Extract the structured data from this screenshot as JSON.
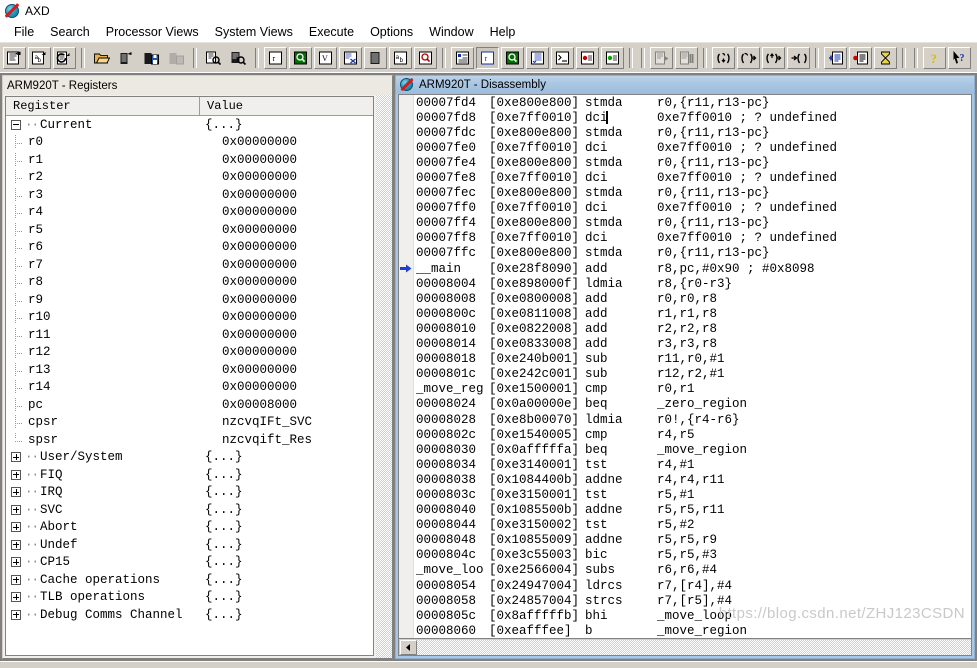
{
  "window": {
    "title": "AXD",
    "icon": "axd-app-icon"
  },
  "menu": {
    "items": [
      {
        "label": "File"
      },
      {
        "label": "Search"
      },
      {
        "label": "Processor Views"
      },
      {
        "label": "System Views"
      },
      {
        "label": "Execute"
      },
      {
        "label": "Options"
      },
      {
        "label": "Window"
      },
      {
        "label": "Help"
      }
    ]
  },
  "toolbar": {
    "groups": [
      {
        "buttons": [
          {
            "name": "load-image-icon",
            "tip": "Load Image",
            "state": "normal"
          },
          {
            "name": "load-debug-symbols-icon",
            "tip": "Load Debug Symbols",
            "state": "normal"
          },
          {
            "name": "reload-image-icon",
            "tip": "Reload Current Image",
            "state": "normal"
          }
        ]
      },
      {
        "buttons": [
          {
            "name": "open-file-icon",
            "tip": "Open File",
            "state": "normal"
          },
          {
            "name": "load-session-icon",
            "tip": "Load Session",
            "state": "normal"
          },
          {
            "name": "save-session-icon",
            "tip": "Save Session",
            "state": "normal"
          },
          {
            "name": "save-session-as-icon",
            "tip": "Save Session As",
            "state": "disabled"
          }
        ]
      },
      {
        "buttons": [
          {
            "name": "find-icon",
            "tip": "Find",
            "state": "normal"
          },
          {
            "name": "find-next-icon",
            "tip": "Find Next",
            "state": "normal"
          }
        ]
      },
      {
        "buttons": [
          {
            "name": "registers-view-icon",
            "tip": "Registers",
            "state": "normal"
          },
          {
            "name": "memory-view-icon",
            "tip": "Memory",
            "state": "normal"
          },
          {
            "name": "variables-view-icon",
            "tip": "Variables",
            "state": "normal"
          },
          {
            "name": "watch-view-icon",
            "tip": "Watch",
            "state": "normal"
          },
          {
            "name": "stack-view-icon",
            "tip": "Backtrace",
            "state": "normal"
          },
          {
            "name": "low-level-symbols-icon",
            "tip": "Low Level Symbols",
            "state": "normal"
          },
          {
            "name": "search-view-icon",
            "tip": "Search",
            "state": "normal"
          }
        ]
      },
      {
        "buttons": [
          {
            "name": "source-view-icon",
            "tip": "Source View",
            "state": "normal"
          },
          {
            "name": "disassembly-view-icon",
            "tip": "Disassembly",
            "state": "pressed"
          },
          {
            "name": "memory-map-icon",
            "tip": "Memory Map",
            "state": "normal"
          },
          {
            "name": "output-view-icon",
            "tip": "Output",
            "state": "normal"
          },
          {
            "name": "console-view-icon",
            "tip": "Console",
            "state": "normal"
          },
          {
            "name": "breakpoints-view-icon",
            "tip": "Breakpoints",
            "state": "normal"
          },
          {
            "name": "watchpoints-view-icon",
            "tip": "Watchpoints",
            "state": "normal"
          }
        ]
      },
      {
        "buttons": [
          {
            "name": "go-icon",
            "tip": "Go",
            "state": "disabled"
          },
          {
            "name": "stop-icon",
            "tip": "Stop",
            "state": "disabled"
          }
        ]
      },
      {
        "buttons": [
          {
            "name": "step-in-icon",
            "tip": "Step In",
            "state": "normal"
          },
          {
            "name": "step-icon",
            "tip": "Step",
            "state": "normal"
          },
          {
            "name": "step-out-icon",
            "tip": "Step Out",
            "state": "normal"
          },
          {
            "name": "run-to-cursor-icon",
            "tip": "Run To Cursor",
            "state": "normal"
          }
        ]
      },
      {
        "buttons": [
          {
            "name": "toggle-breakpoint-icon",
            "tip": "Toggle Breakpoint",
            "state": "normal"
          },
          {
            "name": "toggle-watchpoint-icon",
            "tip": "Toggle Watchpoint",
            "state": "normal"
          },
          {
            "name": "context-icon",
            "tip": "Processor Status",
            "state": "normal"
          }
        ]
      },
      {
        "buttons": [
          {
            "name": "help-icon",
            "tip": "Help",
            "state": "normal"
          },
          {
            "name": "context-help-icon",
            "tip": "Context Help",
            "state": "normal"
          }
        ]
      }
    ]
  },
  "registers_window": {
    "title": "ARM920T - Registers",
    "active": false,
    "columns": [
      "Register",
      "Value"
    ],
    "rows": [
      {
        "name": "Current",
        "value": "{...}",
        "level": 0,
        "expander": "minus"
      },
      {
        "name": "r0",
        "value": "0x00000000",
        "level": 1,
        "expander": "none"
      },
      {
        "name": "r1",
        "value": "0x00000000",
        "level": 1,
        "expander": "none"
      },
      {
        "name": "r2",
        "value": "0x00000000",
        "level": 1,
        "expander": "none"
      },
      {
        "name": "r3",
        "value": "0x00000000",
        "level": 1,
        "expander": "none"
      },
      {
        "name": "r4",
        "value": "0x00000000",
        "level": 1,
        "expander": "none"
      },
      {
        "name": "r5",
        "value": "0x00000000",
        "level": 1,
        "expander": "none"
      },
      {
        "name": "r6",
        "value": "0x00000000",
        "level": 1,
        "expander": "none"
      },
      {
        "name": "r7",
        "value": "0x00000000",
        "level": 1,
        "expander": "none"
      },
      {
        "name": "r8",
        "value": "0x00000000",
        "level": 1,
        "expander": "none"
      },
      {
        "name": "r9",
        "value": "0x00000000",
        "level": 1,
        "expander": "none"
      },
      {
        "name": "r10",
        "value": "0x00000000",
        "level": 1,
        "expander": "none"
      },
      {
        "name": "r11",
        "value": "0x00000000",
        "level": 1,
        "expander": "none"
      },
      {
        "name": "r12",
        "value": "0x00000000",
        "level": 1,
        "expander": "none"
      },
      {
        "name": "r13",
        "value": "0x00000000",
        "level": 1,
        "expander": "none"
      },
      {
        "name": "r14",
        "value": "0x00000000",
        "level": 1,
        "expander": "none"
      },
      {
        "name": "pc",
        "value": "0x00008000",
        "level": 1,
        "expander": "none"
      },
      {
        "name": "cpsr",
        "value": "nzcvqIFt_SVC",
        "level": 1,
        "expander": "none"
      },
      {
        "name": "spsr",
        "value": "nzcvqift_Res",
        "level": 1,
        "expander": "none",
        "last": true
      },
      {
        "name": "User/System",
        "value": "{...}",
        "level": 0,
        "expander": "plus"
      },
      {
        "name": "FIQ",
        "value": "{...}",
        "level": 0,
        "expander": "plus"
      },
      {
        "name": "IRQ",
        "value": "{...}",
        "level": 0,
        "expander": "plus"
      },
      {
        "name": "SVC",
        "value": "{...}",
        "level": 0,
        "expander": "plus"
      },
      {
        "name": "Abort",
        "value": "{...}",
        "level": 0,
        "expander": "plus"
      },
      {
        "name": "Undef",
        "value": "{...}",
        "level": 0,
        "expander": "plus"
      },
      {
        "name": "CP15",
        "value": "{...}",
        "level": 0,
        "expander": "plus"
      },
      {
        "name": "Cache operations",
        "value": "{...}",
        "level": 0,
        "expander": "plus"
      },
      {
        "name": "TLB operations",
        "value": "{...}",
        "level": 0,
        "expander": "plus"
      },
      {
        "name": "Debug Comms Channel",
        "value": "{...}",
        "level": 0,
        "expander": "plus"
      }
    ]
  },
  "disassembly_window": {
    "title": "ARM920T - Disassembly",
    "active": true,
    "current_marker": "pc-arrow",
    "caret_visible_row": 1,
    "rows": [
      {
        "addr": "00007fd4",
        "opcode": "[0xe800e800]",
        "mnemonic": "stmda",
        "args": "r0,{r11,r13-pc}",
        "current": false
      },
      {
        "addr": "00007fd8",
        "opcode": "[0xe7ff0010]",
        "mnemonic": "dci",
        "args": "0xe7ff0010 ; ? undefined",
        "current": false
      },
      {
        "addr": "00007fdc",
        "opcode": "[0xe800e800]",
        "mnemonic": "stmda",
        "args": "r0,{r11,r13-pc}",
        "current": false
      },
      {
        "addr": "00007fe0",
        "opcode": "[0xe7ff0010]",
        "mnemonic": "dci",
        "args": "0xe7ff0010 ; ? undefined",
        "current": false
      },
      {
        "addr": "00007fe4",
        "opcode": "[0xe800e800]",
        "mnemonic": "stmda",
        "args": "r0,{r11,r13-pc}",
        "current": false
      },
      {
        "addr": "00007fe8",
        "opcode": "[0xe7ff0010]",
        "mnemonic": "dci",
        "args": "0xe7ff0010 ; ? undefined",
        "current": false
      },
      {
        "addr": "00007fec",
        "opcode": "[0xe800e800]",
        "mnemonic": "stmda",
        "args": "r0,{r11,r13-pc}",
        "current": false
      },
      {
        "addr": "00007ff0",
        "opcode": "[0xe7ff0010]",
        "mnemonic": "dci",
        "args": "0xe7ff0010 ; ? undefined",
        "current": false
      },
      {
        "addr": "00007ff4",
        "opcode": "[0xe800e800]",
        "mnemonic": "stmda",
        "args": "r0,{r11,r13-pc}",
        "current": false
      },
      {
        "addr": "00007ff8",
        "opcode": "[0xe7ff0010]",
        "mnemonic": "dci",
        "args": "0xe7ff0010 ; ? undefined",
        "current": false
      },
      {
        "addr": "00007ffc",
        "opcode": "[0xe800e800]",
        "mnemonic": "stmda",
        "args": "r0,{r11,r13-pc}",
        "current": false
      },
      {
        "addr": "__main",
        "opcode": "[0xe28f8090]",
        "mnemonic": "add",
        "args": "r8,pc,#0x90 ; #0x8098",
        "current": true
      },
      {
        "addr": "00008004",
        "opcode": "[0xe898000f]",
        "mnemonic": "ldmia",
        "args": "r8,{r0-r3}",
        "current": false
      },
      {
        "addr": "00008008",
        "opcode": "[0xe0800008]",
        "mnemonic": "add",
        "args": "r0,r0,r8",
        "current": false
      },
      {
        "addr": "0000800c",
        "opcode": "[0xe0811008]",
        "mnemonic": "add",
        "args": "r1,r1,r8",
        "current": false
      },
      {
        "addr": "00008010",
        "opcode": "[0xe0822008]",
        "mnemonic": "add",
        "args": "r2,r2,r8",
        "current": false
      },
      {
        "addr": "00008014",
        "opcode": "[0xe0833008]",
        "mnemonic": "add",
        "args": "r3,r3,r8",
        "current": false
      },
      {
        "addr": "00008018",
        "opcode": "[0xe240b001]",
        "mnemonic": "sub",
        "args": "r11,r0,#1",
        "current": false
      },
      {
        "addr": "0000801c",
        "opcode": "[0xe242c001]",
        "mnemonic": "sub",
        "args": "r12,r2,#1",
        "current": false
      },
      {
        "addr": "_move_reg",
        "opcode": "[0xe1500001]",
        "mnemonic": "cmp",
        "args": "r0,r1",
        "current": false
      },
      {
        "addr": "00008024",
        "opcode": "[0x0a00000e]",
        "mnemonic": "beq",
        "args": "_zero_region",
        "current": false
      },
      {
        "addr": "00008028",
        "opcode": "[0xe8b00070]",
        "mnemonic": "ldmia",
        "args": "r0!,{r4-r6}",
        "current": false
      },
      {
        "addr": "0000802c",
        "opcode": "[0xe1540005]",
        "mnemonic": "cmp",
        "args": "r4,r5",
        "current": false
      },
      {
        "addr": "00008030",
        "opcode": "[0x0afffffa]",
        "mnemonic": "beq",
        "args": "_move_region",
        "current": false
      },
      {
        "addr": "00008034",
        "opcode": "[0xe3140001]",
        "mnemonic": "tst",
        "args": "r4,#1",
        "current": false
      },
      {
        "addr": "00008038",
        "opcode": "[0x1084400b]",
        "mnemonic": "addne",
        "args": "r4,r4,r11",
        "current": false
      },
      {
        "addr": "0000803c",
        "opcode": "[0xe3150001]",
        "mnemonic": "tst",
        "args": "r5,#1",
        "current": false
      },
      {
        "addr": "00008040",
        "opcode": "[0x1085500b]",
        "mnemonic": "addne",
        "args": "r5,r5,r11",
        "current": false
      },
      {
        "addr": "00008044",
        "opcode": "[0xe3150002]",
        "mnemonic": "tst",
        "args": "r5,#2",
        "current": false
      },
      {
        "addr": "00008048",
        "opcode": "[0x10855009]",
        "mnemonic": "addne",
        "args": "r5,r5,r9",
        "current": false
      },
      {
        "addr": "0000804c",
        "opcode": "[0xe3c55003]",
        "mnemonic": "bic",
        "args": "r5,r5,#3",
        "current": false
      },
      {
        "addr": "_move_loo",
        "opcode": "[0xe2566004]",
        "mnemonic": "subs",
        "args": "r6,r6,#4",
        "current": false
      },
      {
        "addr": "00008054",
        "opcode": "[0x24947004]",
        "mnemonic": "ldrcs",
        "args": "r7,[r4],#4",
        "current": false
      },
      {
        "addr": "00008058",
        "opcode": "[0x24857004]",
        "mnemonic": "strcs",
        "args": "r7,[r5],#4",
        "current": false
      },
      {
        "addr": "0000805c",
        "opcode": "[0x8afffffb]",
        "mnemonic": "bhi",
        "args": "_move_loop",
        "current": false
      },
      {
        "addr": "00008060",
        "opcode": "[0xeafffee]",
        "mnemonic": "b",
        "args": "_move_region",
        "current": false
      }
    ]
  },
  "watermark": {
    "text": "https://blog.csdn.net/ZHJ123CSDN"
  },
  "colors": {
    "title_active": "#a9c6e2",
    "face": "#d4d0c8",
    "workspace": "#808080",
    "arrow_blue": "#1f3fcf",
    "accent_green": "#007000"
  }
}
